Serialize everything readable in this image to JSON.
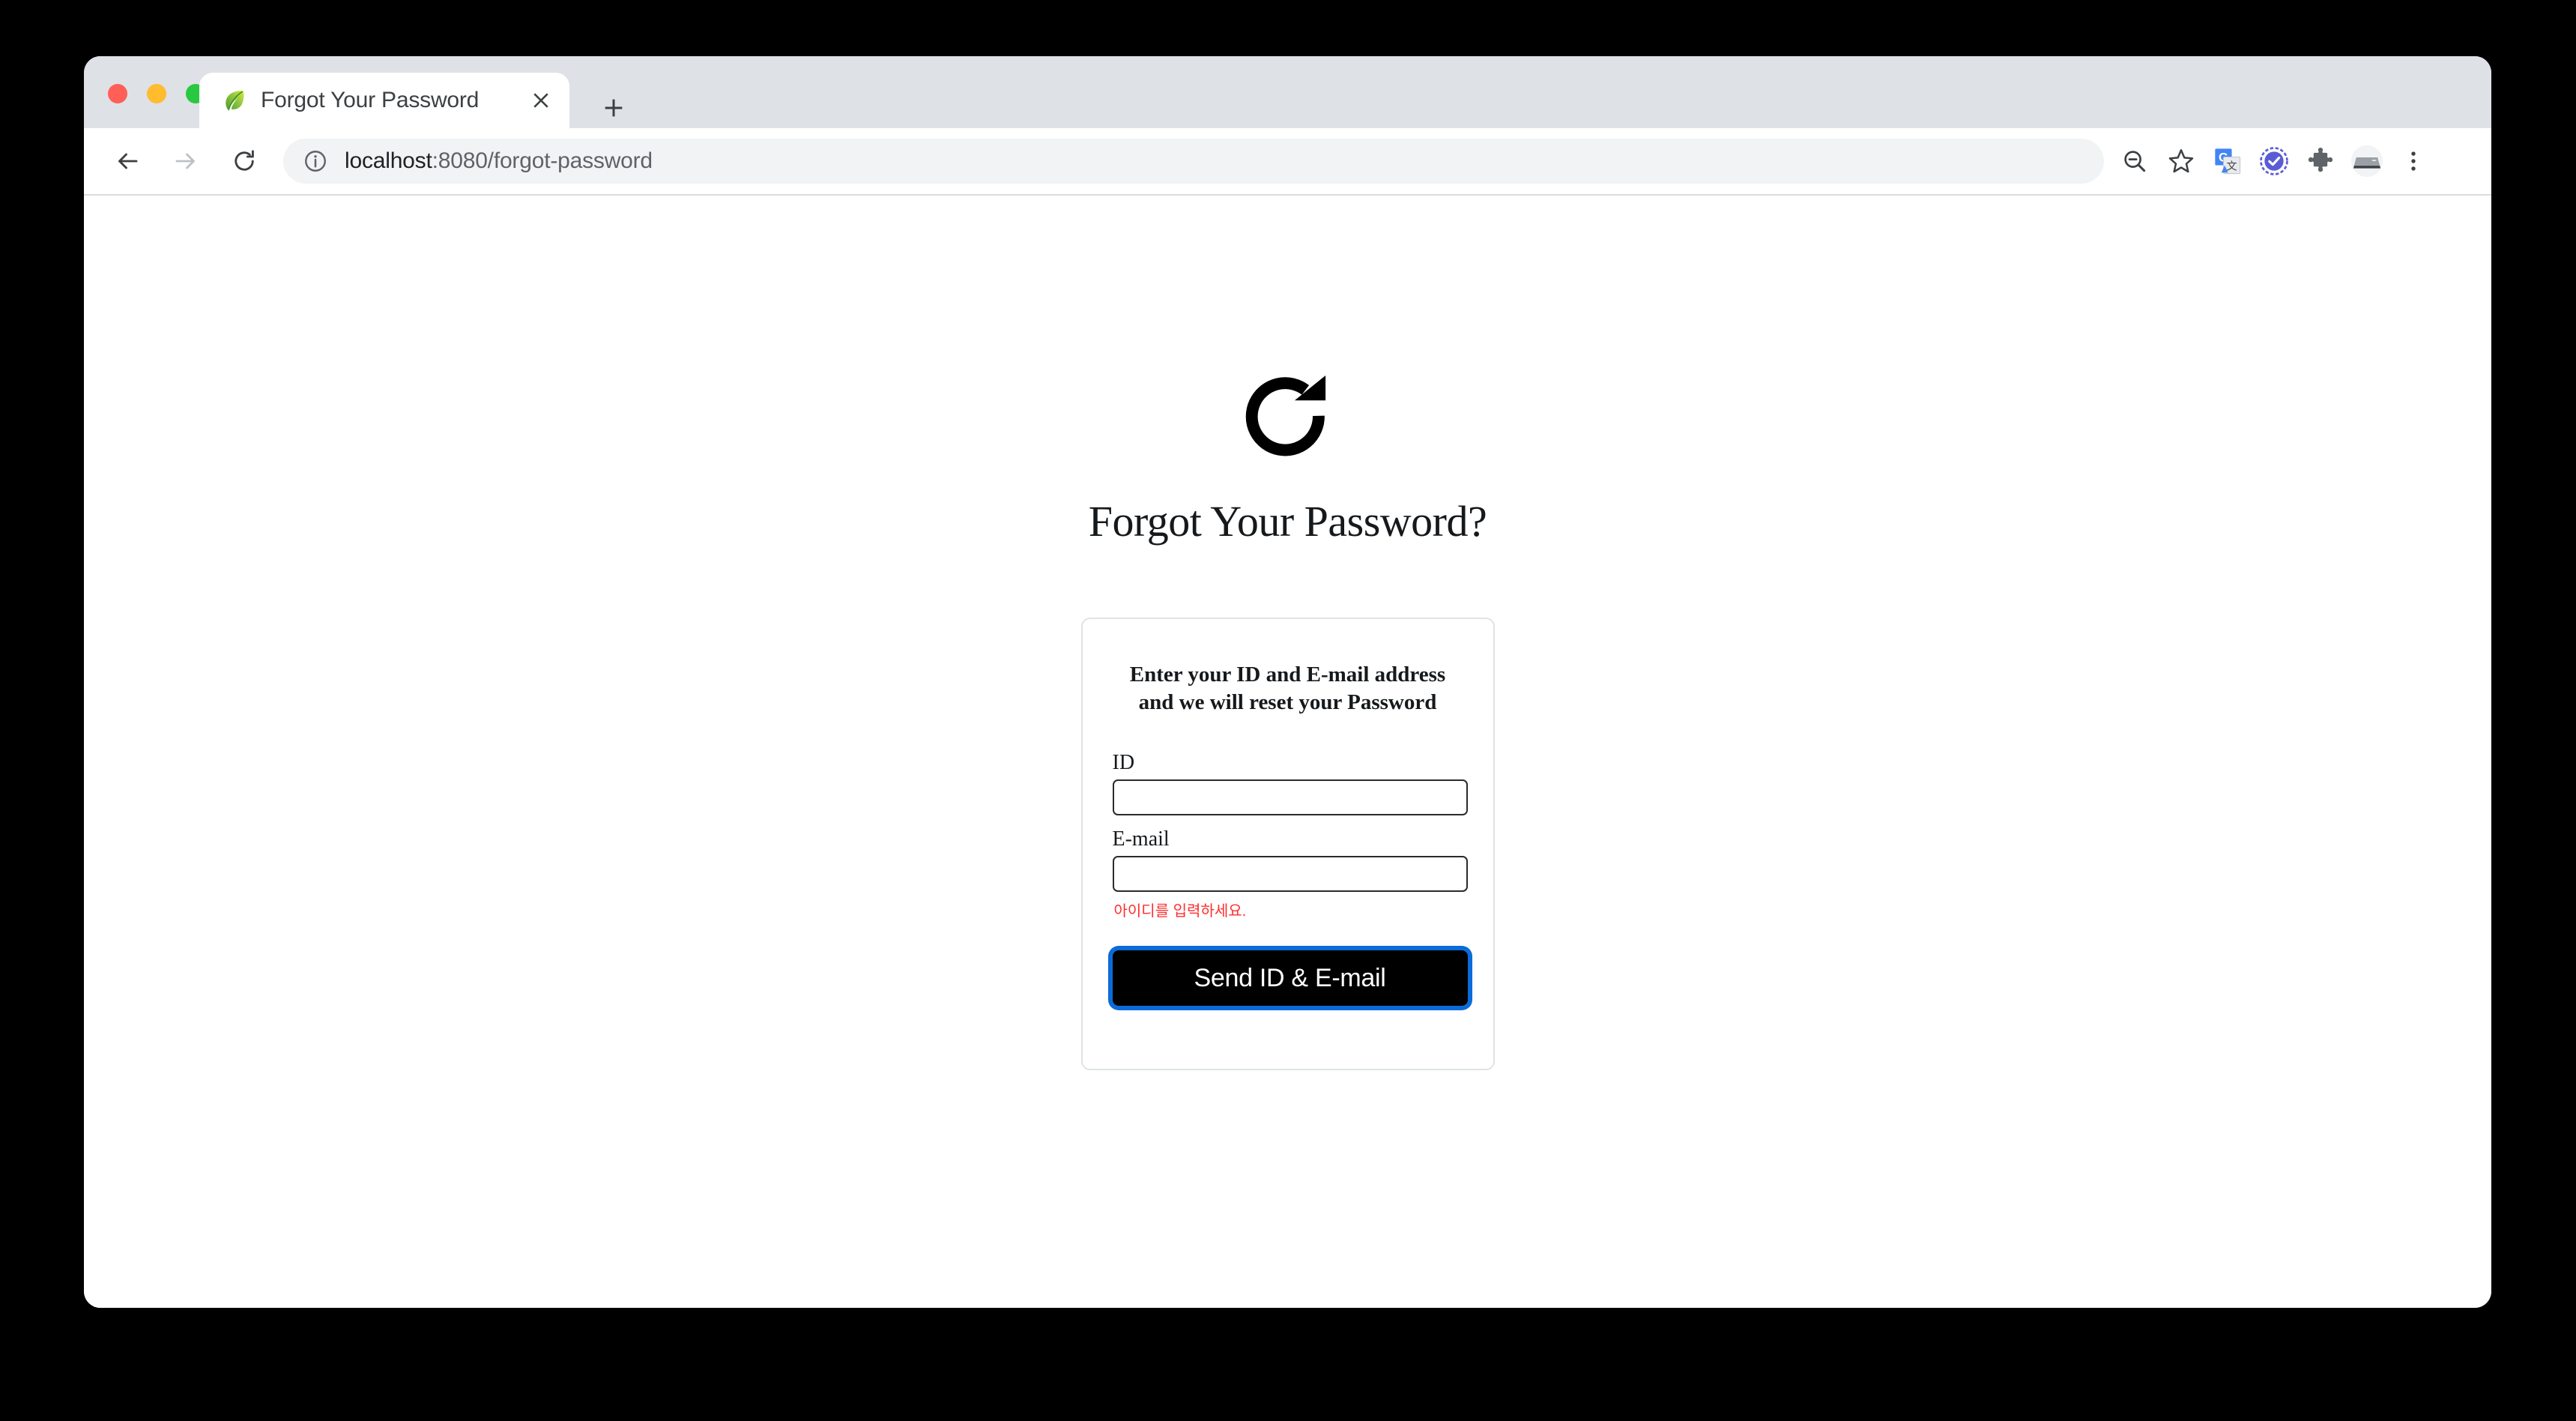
{
  "window": {
    "traffic_lights": [
      "close",
      "minimize",
      "zoom"
    ],
    "colors": {
      "tabstrip_bg": "#dee1e6",
      "omnibox_bg": "#f1f3f4",
      "focus_ring": "#0b6bd8",
      "error_text": "#ff2d2d",
      "button_bg": "#000000",
      "card_border": "#dfe3e6",
      "input_border": "#2b2b2b"
    }
  },
  "tabs": [
    {
      "title": "Forgot Your Password",
      "favicon": "spring-leaf-icon",
      "active": true,
      "close_label": "×"
    }
  ],
  "newtab": {
    "label": "+"
  },
  "toolbar": {
    "back_label": "Back",
    "forward_label": "Forward",
    "reload_label": "Reload",
    "omnibox": {
      "security_icon": "info-circle-icon",
      "host": "localhost",
      "rest": ":8080/forgot-password",
      "full_url": "localhost:8080/forgot-password"
    },
    "actions": [
      {
        "name": "zoom-out-icon",
        "label": "Zoom out"
      },
      {
        "name": "bookmark-star-icon",
        "label": "Bookmark this tab"
      },
      {
        "name": "google-translate-icon",
        "label": "Google Translate"
      },
      {
        "name": "check-circle-extension-icon",
        "label": "Extension"
      },
      {
        "name": "puzzle-piece-icon",
        "label": "Extensions"
      },
      {
        "name": "profile-avatar-icon",
        "label": "Profile"
      },
      {
        "name": "three-dot-menu-icon",
        "label": "Customize and control"
      }
    ]
  },
  "page": {
    "hero_icon": "refresh-circular-arrow-icon",
    "title": "Forgot Your Password?",
    "card": {
      "subtitle_line1": "Enter your ID and E-mail address",
      "subtitle_line2": "and we will reset your Password",
      "fields": [
        {
          "label": "ID",
          "value": "",
          "placeholder": "",
          "type": "text"
        },
        {
          "label": "E-mail",
          "value": "",
          "placeholder": "",
          "type": "text"
        }
      ],
      "error": "아이디를 입력하세요.",
      "submit_label": "Send ID & E-mail"
    }
  }
}
